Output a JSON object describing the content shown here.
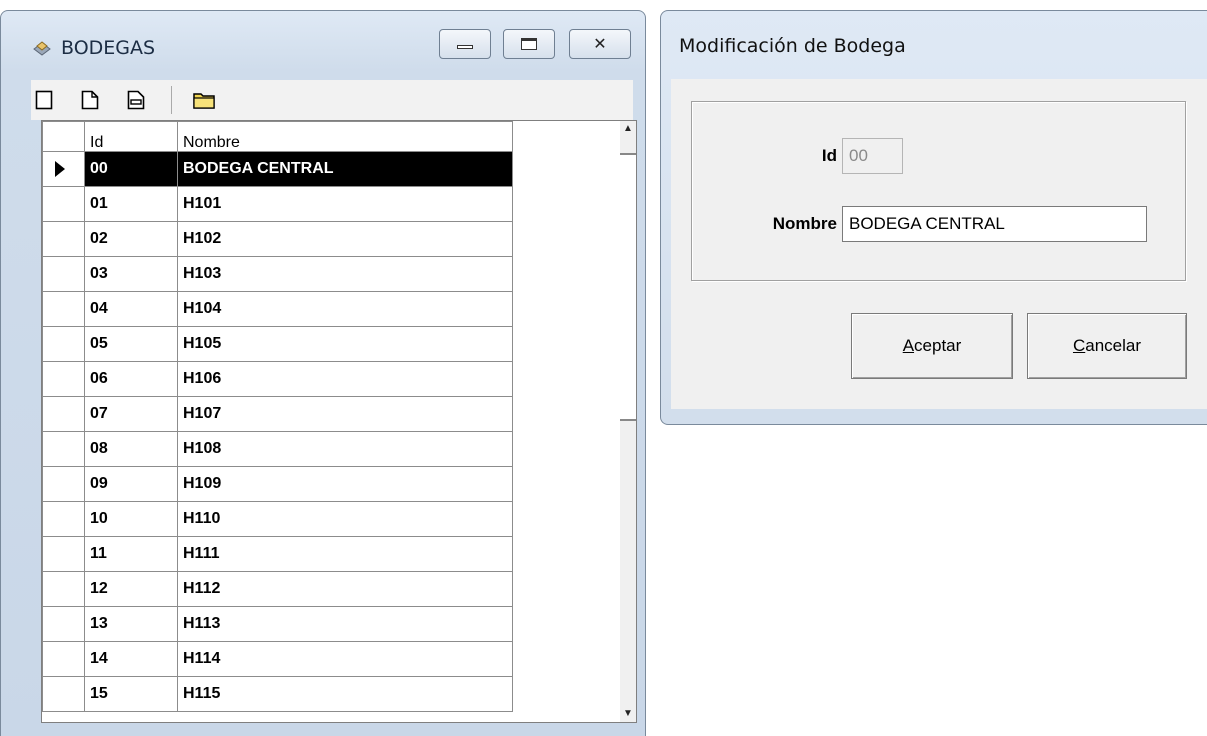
{
  "bodegas_window": {
    "title": "BODEGAS",
    "grid": {
      "columns": [
        "Id",
        "Nombre"
      ],
      "rows": [
        {
          "id": "00",
          "nombre": "BODEGA CENTRAL"
        },
        {
          "id": "01",
          "nombre": "H101"
        },
        {
          "id": "02",
          "nombre": "H102"
        },
        {
          "id": "03",
          "nombre": "H103"
        },
        {
          "id": "04",
          "nombre": "H104"
        },
        {
          "id": "05",
          "nombre": "H105"
        },
        {
          "id": "06",
          "nombre": "H106"
        },
        {
          "id": "07",
          "nombre": "H107"
        },
        {
          "id": "08",
          "nombre": "H108"
        },
        {
          "id": "09",
          "nombre": "H109"
        },
        {
          "id": "10",
          "nombre": "H110"
        },
        {
          "id": "11",
          "nombre": "H111"
        },
        {
          "id": "12",
          "nombre": "H112"
        },
        {
          "id": "13",
          "nombre": "H113"
        },
        {
          "id": "14",
          "nombre": "H114"
        },
        {
          "id": "15",
          "nombre": "H115"
        }
      ],
      "selected_index": 0
    },
    "toolbar_icons": [
      "blank-icon",
      "new-document-icon",
      "edit-document-icon",
      "open-folder-icon"
    ]
  },
  "modificacion_dialog": {
    "title": "Modificación de Bodega",
    "fields": {
      "id_label": "Id",
      "id_value": "00",
      "nombre_label": "Nombre",
      "nombre_value": "BODEGA CENTRAL"
    },
    "buttons": {
      "aceptar_mnemonic": "A",
      "aceptar_rest": "ceptar",
      "cancelar_mnemonic": "C",
      "cancelar_rest": "ancelar"
    }
  },
  "colors": {
    "title_bar": "#cfdceb",
    "selected_row_bg": "#000000",
    "selected_row_fg": "#ffffff",
    "dialog_body": "#f0f0f0"
  }
}
